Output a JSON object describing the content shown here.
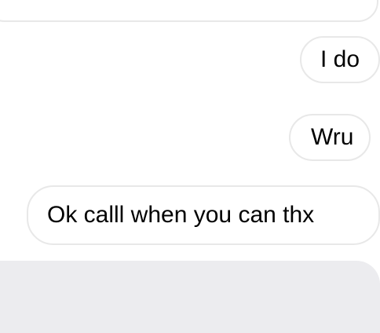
{
  "messages": [
    {
      "text": ""
    },
    {
      "text": "I do"
    },
    {
      "text": "Wru"
    },
    {
      "text": "Ok calll when you can thx"
    }
  ]
}
